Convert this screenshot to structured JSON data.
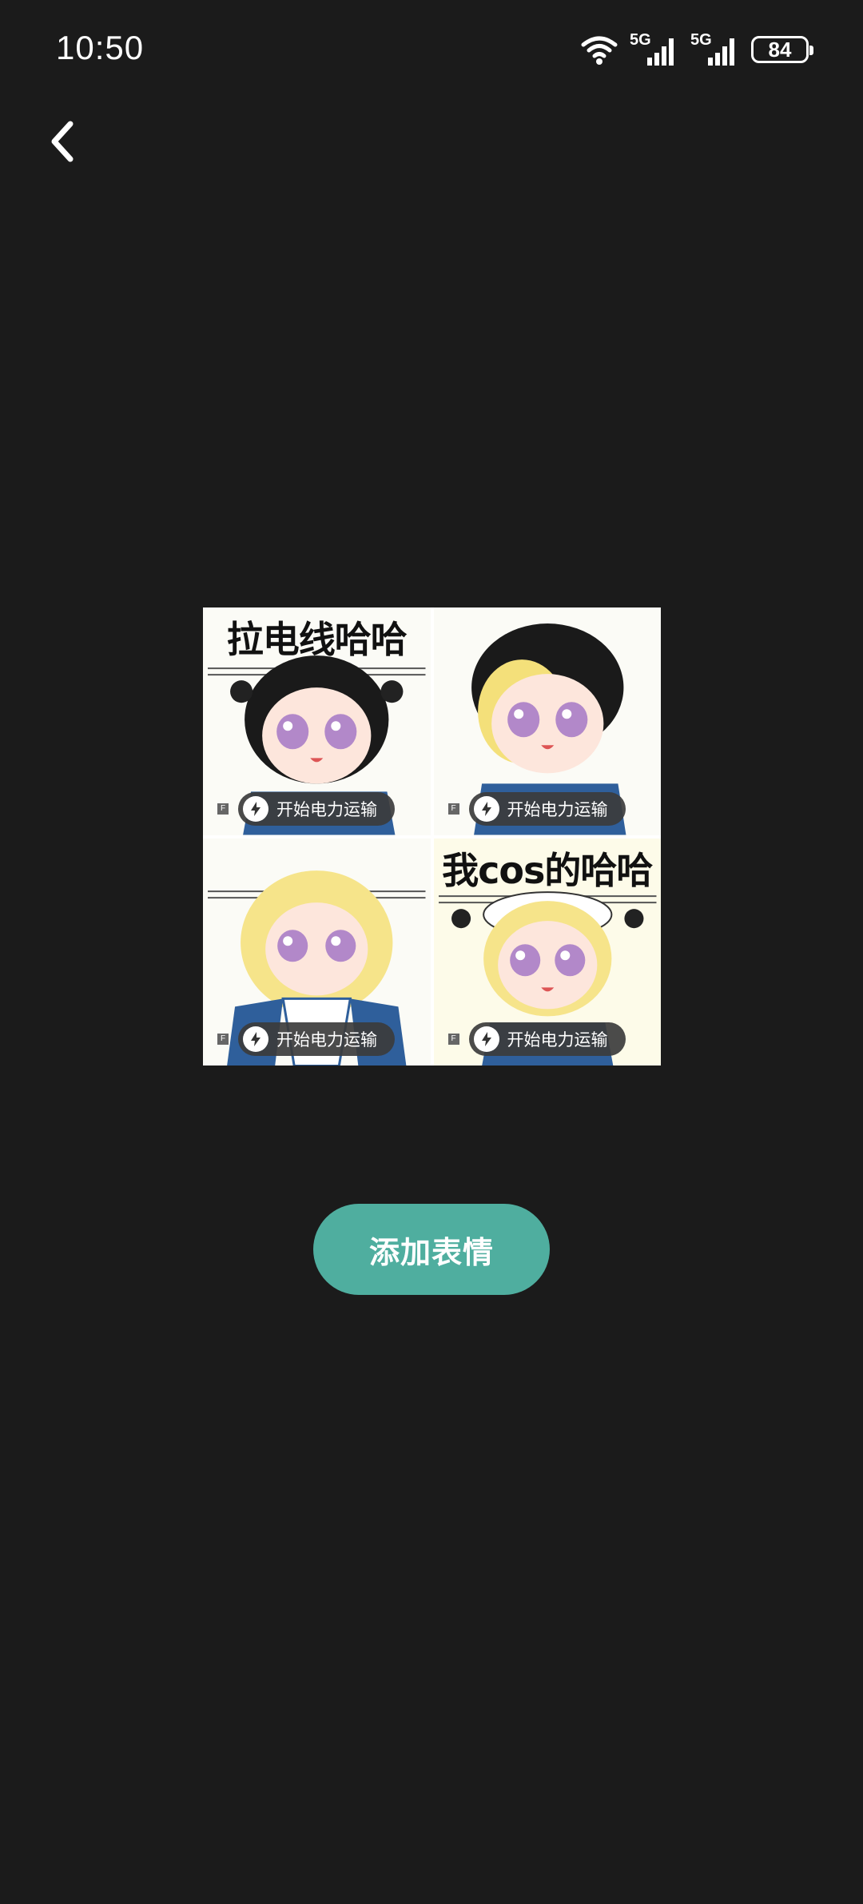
{
  "status_bar": {
    "time": "10:50",
    "signal_1_label": "5G",
    "signal_2_label": "5G",
    "battery": "84",
    "icons": [
      "wifi-icon",
      "signal-icon",
      "signal-icon",
      "battery-icon"
    ]
  },
  "nav": {
    "back_icon": "chevron-left-icon"
  },
  "sticker_grid": {
    "tiles": [
      {
        "caption": "拉电线哈哈",
        "badge": "F",
        "pill_text": "开始电力运输",
        "pill_icon": "lightning-icon"
      },
      {
        "caption": "",
        "badge": "F",
        "pill_text": "开始电力运输",
        "pill_icon": "lightning-icon"
      },
      {
        "caption": "",
        "badge": "F",
        "pill_text": "开始电力运输",
        "pill_icon": "lightning-icon"
      },
      {
        "caption": "我cos的哈哈",
        "badge": "F",
        "pill_text": "开始电力运输",
        "pill_icon": "lightning-icon"
      }
    ]
  },
  "actions": {
    "add_sticker_label": "添加表情"
  },
  "colors": {
    "background": "#1b1b1b",
    "accent": "#4fae9f"
  }
}
